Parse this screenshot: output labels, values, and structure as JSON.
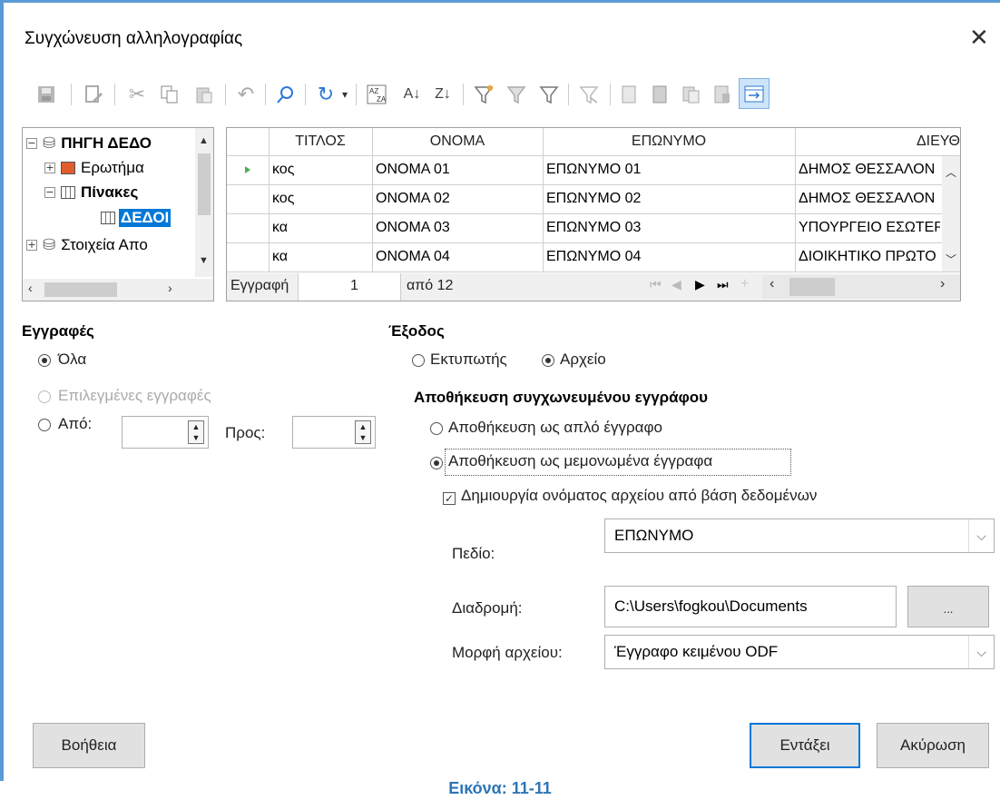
{
  "dialog": {
    "title": "Συγχώνευση αλληλογραφίας"
  },
  "toolbar": {
    "icons": [
      "save-icon",
      "edit-icon",
      "cut-icon",
      "copy-icon",
      "paste-icon",
      "undo-icon",
      "find-icon",
      "refresh-icon",
      "dropdown-icon",
      "form-icon",
      "sort-ascending-icon",
      "sort-descending-icon",
      "autofilter-icon",
      "standard-filter-icon",
      "filter-icon",
      "remove-filter-icon",
      "data-to-text-icon",
      "data-to-fields-icon",
      "mail-merge-icon",
      "source-icon",
      "explorer-icon"
    ]
  },
  "tree": {
    "source": "ΠΗΓΗ ΔΕΔΟ",
    "queries": "Ερωτήμα",
    "tables": "Πίνακες",
    "table": "ΔΕΔΟΙ",
    "misc": "Στοιχεία Απο"
  },
  "grid": {
    "columns": [
      "ΤΙΤΛΟΣ",
      "ΟΝΟΜΑ",
      "ΕΠΩΝΥΜΟ",
      "ΔΙΕΥΘ"
    ],
    "rows": [
      [
        "κος",
        "ΟΝΟΜΑ 01",
        "ΕΠΩΝΥΜΟ 01",
        "ΔΗΜΟΣ ΘΕΣΣΑΛΟΝ"
      ],
      [
        "κος",
        "ΟΝΟΜΑ 02",
        "ΕΠΩΝΥΜΟ 02",
        "ΔΗΜΟΣ ΘΕΣΣΑΛΟΝ"
      ],
      [
        "κα",
        "ΟΝΟΜΑ 03",
        "ΕΠΩΝΥΜΟ 03",
        "ΥΠΟΥΡΓΕΙΟ ΕΣΩΤΕΡ"
      ],
      [
        "κα",
        "ΟΝΟΜΑ 04",
        "ΕΠΩΝΥΜΟ 04",
        "ΔΙΟΙΚΗΤΙΚΟ ΠΡΩΤΟ"
      ]
    ],
    "record_label": "Εγγραφή",
    "record_value": "1",
    "of_label": "από 12"
  },
  "records": {
    "heading": "Εγγραφές",
    "all": "Όλα",
    "selected": "Επιλεγμένες εγγραφές",
    "from": "Από:",
    "to": "Προς:",
    "from_value": "",
    "to_value": ""
  },
  "output": {
    "heading": "Έξοδος",
    "printer": "Εκτυπωτής",
    "file": "Αρχείο",
    "save_heading": "Αποθήκευση συγχωνευμένου εγγράφου",
    "save_single": "Αποθήκευση ως απλό έγγραφο",
    "save_individual": "Αποθήκευση ως μεμονωμένα έγγραφα",
    "generate_name": "Δημιουργία ονόματος αρχείου από βάση δεδομένων",
    "field_label": "Πεδίο:",
    "field_value": "ΕΠΩΝΥΜΟ",
    "path_label": "Διαδρομή:",
    "path_value": "C:\\Users\\fogkou\\Documents",
    "browse": "...",
    "format_label": "Μορφή αρχείου:",
    "format_value": "Έγγραφο κειμένου ODF"
  },
  "buttons": {
    "help": "Βοήθεια",
    "ok": "Εντάξει",
    "cancel": "Ακύρωση"
  },
  "caption": "Εικόνα: 11-11",
  "colors": {
    "accent": "#0078d7",
    "caption": "#2e75b6",
    "selection": "#0078d7"
  }
}
